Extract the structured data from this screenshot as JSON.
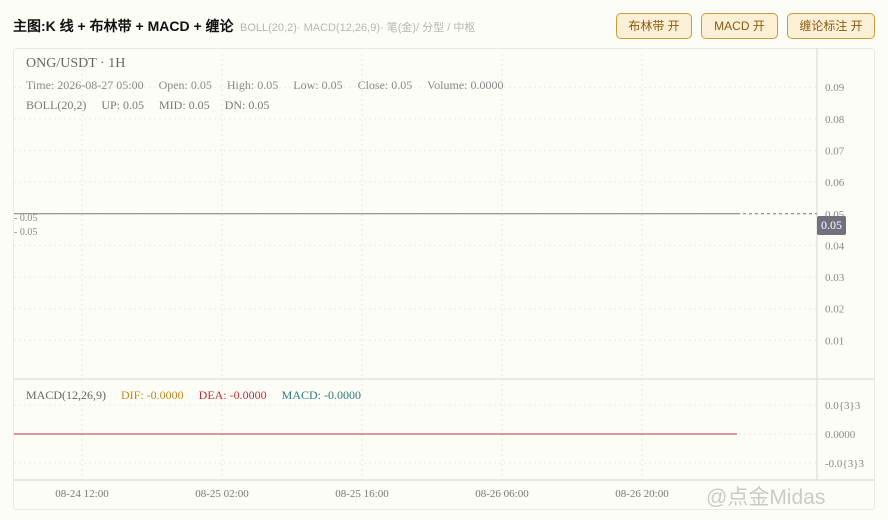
{
  "header": {
    "title": "主图:K 线 + 布林带 + MACD + 缠论",
    "subtitle": "BOLL(20,2)· MACD(12,26,9)· 笔(金)/ 分型 / 中枢",
    "buttons": {
      "boll": "布林带 开",
      "macd": "MACD 开",
      "chan": "缠论标注 开"
    }
  },
  "info": {
    "symbol": "ONG/USDT · 1H",
    "time": "Time: 2026-08-27 05:00",
    "open": "Open: 0.05",
    "high": "High: 0.05",
    "low": "Low: 0.05",
    "close": "Close: 0.05",
    "volume": "Volume: 0.0000",
    "boll_label": "BOLL(20,2)",
    "boll_up": "UP: 0.05",
    "boll_mid": "MID: 0.05",
    "boll_dn": "DN: 0.05"
  },
  "macd": {
    "label": "MACD(12,26,9)",
    "dif": "DIF: -0.0000",
    "dea": "DEA: -0.0000",
    "macd": "MACD: -0.0000"
  },
  "price_tag": "0.05",
  "watermark": "@点金Midas",
  "chart_data": [
    {
      "type": "line",
      "title": "ONG/USDT · 1H",
      "x": [
        "08-24 12:00",
        "08-25 02:00",
        "08-25 16:00",
        "08-26 06:00",
        "08-26 20:00",
        "08-27 05:00"
      ],
      "x_ticks": [
        "08-24 12:00",
        "08-25 02:00",
        "08-25 16:00",
        "08-26 06:00",
        "08-26 20:00"
      ],
      "series": [
        {
          "name": "Close",
          "values": [
            0.05,
            0.05,
            0.05,
            0.05,
            0.05,
            0.05
          ]
        }
      ],
      "y_ticks": [
        "0.01",
        "0.02",
        "0.03",
        "0.04",
        "0.05",
        "0.06",
        "0.07",
        "0.08",
        "0.09"
      ],
      "side_labels": [
        "- 0.05",
        "- 0.05"
      ],
      "ylim": [
        0,
        0.1
      ],
      "grid": true
    },
    {
      "type": "line",
      "title": "MACD(12,26,9)",
      "x": [
        "08-24 12:00",
        "08-25 02:00",
        "08-25 16:00",
        "08-26 06:00",
        "08-26 20:00",
        "08-27 05:00"
      ],
      "series": [
        {
          "name": "DEA",
          "values": [
            0,
            0,
            0,
            0,
            0,
            0
          ],
          "color": "#c0303a"
        }
      ],
      "y_ticks": [
        "-0.0{3}3",
        "0.0000",
        "0.0{3}3"
      ],
      "ylim": [
        -3e-05,
        3e-05
      ],
      "grid": true
    }
  ]
}
